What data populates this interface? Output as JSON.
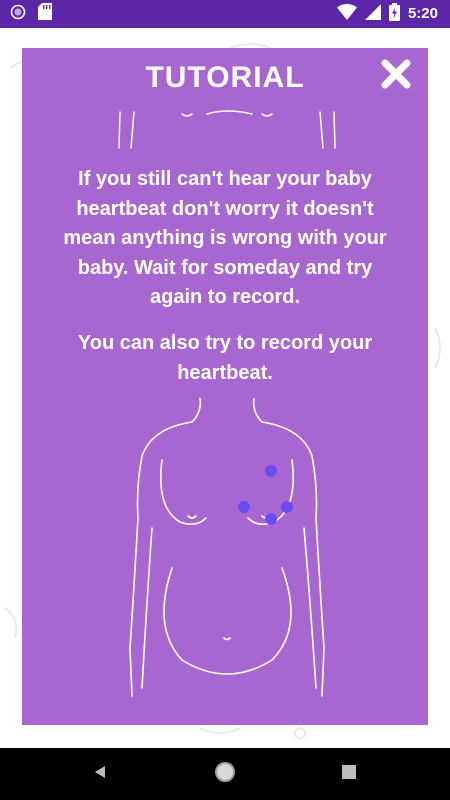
{
  "status_bar": {
    "time": "5:20",
    "icons": [
      "circle-notification-icon",
      "sd-card-icon",
      "wifi-icon",
      "cellular-signal-icon",
      "battery-charging-icon"
    ],
    "color": "#5b27a8"
  },
  "dialog": {
    "title": "TUTORIAL",
    "close_icon": "close-x-icon",
    "background_color": "#a867d0",
    "paragraph_1": "If you still can't hear your baby heartbeat don't worry it doesn't mean anything is wrong with your baby. Wait for someday and try again to record.",
    "paragraph_2": "You can also try to record your heartbeat.",
    "illustration": "pregnant-torso-outline",
    "marker_color": "#6c4cf2"
  },
  "nav_bar": {
    "back_icon": "back-triangle-icon",
    "home_icon": "home-circle-icon",
    "recent_icon": "recent-apps-square-icon"
  }
}
